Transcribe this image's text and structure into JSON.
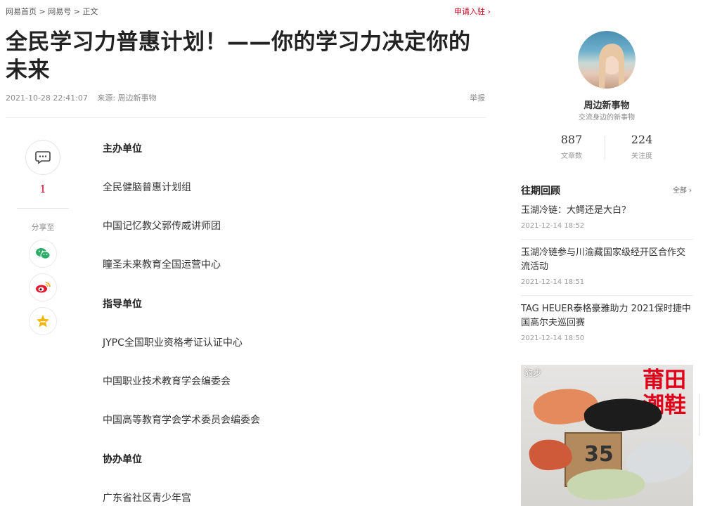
{
  "breadcrumb": {
    "home": "网易首页",
    "sep1": ">",
    "section": "网易号",
    "sep2": ">",
    "current": "正文"
  },
  "apply_link": "申请入驻 ›",
  "article": {
    "title": "全民学习力普惠计划！——你的学习力决定你的未来",
    "datetime": "2021-10-28 22:41:07",
    "source": "来源: 周边新事物",
    "report": "举报",
    "paragraphs": [
      {
        "text": "主办单位",
        "bold": true
      },
      {
        "text": "全民健脑普惠计划组",
        "bold": false
      },
      {
        "text": "中国记忆教父郭传威讲师团",
        "bold": false
      },
      {
        "text": "瞳圣未来教育全国运营中心",
        "bold": false
      },
      {
        "text": "指导单位",
        "bold": true
      },
      {
        "text": "JYPC全国职业资格考证认证中心",
        "bold": false
      },
      {
        "text": "中国职业技术教育学会编委会",
        "bold": false
      },
      {
        "text": "中国高等教育学会学术委员会编委会",
        "bold": false
      },
      {
        "text": "协办单位",
        "bold": true
      },
      {
        "text": "广东省社区青少年宫",
        "bold": false
      }
    ]
  },
  "side_actions": {
    "comment_icon": "comment-icon",
    "comment_count": "1",
    "share_label": "分享至",
    "share": [
      {
        "name": "wechat-icon",
        "color": "#2aae67"
      },
      {
        "name": "weibo-icon",
        "color": "#e6162d"
      },
      {
        "name": "favorite-icon",
        "color": "#f5b400"
      }
    ]
  },
  "author": {
    "name": "周边新事物",
    "desc": "交流身边的新事物",
    "stats": [
      {
        "value": "887",
        "label": "文章数"
      },
      {
        "value": "224",
        "label": "关注度"
      }
    ]
  },
  "past": {
    "title": "往期回顾",
    "all": "全部 ›",
    "items": [
      {
        "title": "玉湖冷链：大鳄还是大白？",
        "date": "2021-12-14 18:52"
      },
      {
        "title": "玉湖冷链参与川渝藏国家级经开区合作交流活动",
        "date": "2021-12-14 18:51"
      },
      {
        "title": "TAG HEUER泰格豪雅助力 2021保时捷中国高尔夫巡回赛",
        "date": "2021-12-14 18:50"
      }
    ]
  },
  "ad": {
    "brand": "豹步",
    "headline": "莆田潮鞋",
    "box_number": "35"
  },
  "colors": {
    "accent": "#d0021b"
  }
}
